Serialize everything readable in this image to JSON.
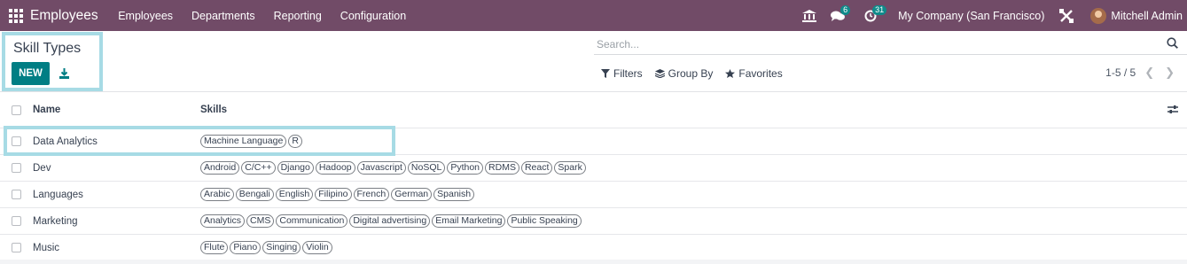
{
  "navbar": {
    "brand": "Employees",
    "menu": [
      "Employees",
      "Departments",
      "Reporting",
      "Configuration"
    ],
    "messages_count": "6",
    "activities_count": "31",
    "company": "My Company (San Francisco)",
    "user": "Mitchell Admin"
  },
  "control_panel": {
    "title": "Skill Types",
    "new_label": "NEW",
    "search_placeholder": "Search...",
    "filters_label": "Filters",
    "group_by_label": "Group By",
    "favorites_label": "Favorites",
    "pager": "1-5 / 5"
  },
  "table": {
    "columns": {
      "name": "Name",
      "skills": "Skills"
    },
    "rows": [
      {
        "name": "Data Analytics",
        "skills": [
          "Machine Language",
          "R"
        ]
      },
      {
        "name": "Dev",
        "skills": [
          "Android",
          "C/C++",
          "Django",
          "Hadoop",
          "Javascript",
          "NoSQL",
          "Python",
          "RDMS",
          "React",
          "Spark"
        ]
      },
      {
        "name": "Languages",
        "skills": [
          "Arabic",
          "Bengali",
          "English",
          "Filipino",
          "French",
          "German",
          "Spanish"
        ]
      },
      {
        "name": "Marketing",
        "skills": [
          "Analytics",
          "CMS",
          "Communication",
          "Digital advertising",
          "Email Marketing",
          "Public Speaking"
        ]
      },
      {
        "name": "Music",
        "skills": [
          "Flute",
          "Piano",
          "Singing",
          "Violin"
        ]
      }
    ]
  },
  "colors": {
    "navbar": "#714B67",
    "primary": "#017e84",
    "highlight": "#a7dbe5",
    "badge": "#0f8a8a"
  }
}
